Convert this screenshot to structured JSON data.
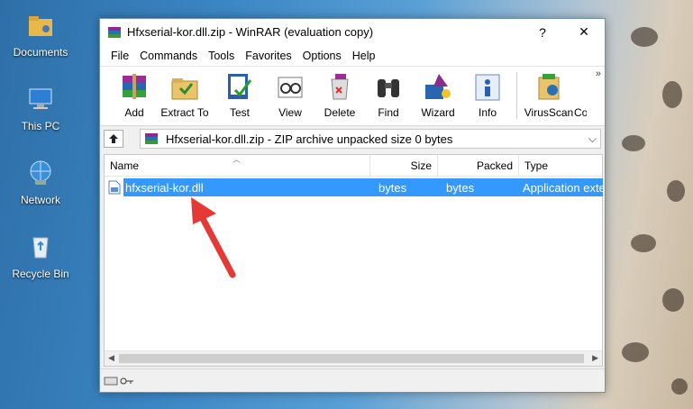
{
  "desktop": {
    "icons": [
      {
        "label": "Documents"
      },
      {
        "label": "This PC"
      },
      {
        "label": "Network"
      },
      {
        "label": "Recycle Bin"
      }
    ]
  },
  "window": {
    "title": "Hfxserial-kor.dll.zip - WinRAR (evaluation copy)",
    "help_button": "?",
    "close_button": "✕",
    "menu": [
      "File",
      "Commands",
      "Tools",
      "Favorites",
      "Options",
      "Help"
    ],
    "toolbar": [
      "Add",
      "Extract To",
      "Test",
      "View",
      "Delete",
      "Find",
      "Wizard",
      "Info",
      "VirusScan",
      "Co"
    ],
    "toolbar_overflow": "»",
    "address": "Hfxserial-kor.dll.zip - ZIP archive unpacked size 0 bytes",
    "columns": [
      "Name",
      "Size",
      "Packed",
      "Type"
    ],
    "files": [
      {
        "name": "hfxserial-kor.dll",
        "size": "bytes",
        "packed": "bytes",
        "type": "Application exte"
      }
    ]
  },
  "colors": {
    "selection": "#3399ff",
    "annotation_arrow": "#e53935"
  }
}
